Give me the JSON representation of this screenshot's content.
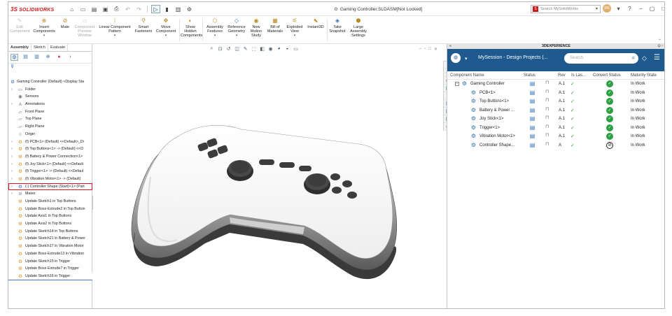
{
  "titlebar": {
    "brand": "SOLIDWORKS",
    "document_title": "Gaming Controller.SLDASM[Not Locked]",
    "search_placeholder": "Search MySolidWorks",
    "avatar_initials": "RN"
  },
  "ribbon": {
    "buttons": [
      {
        "label": "Edit Component",
        "disabled": true
      },
      {
        "label": "Insert Components",
        "disabled": false
      },
      {
        "label": "Mate",
        "disabled": false
      },
      {
        "label": "Component Preview Window",
        "disabled": true
      },
      {
        "label": "Linear Component Pattern",
        "disabled": false
      },
      {
        "label": "Smart Fasteners",
        "disabled": false
      },
      {
        "label": "Move Component",
        "disabled": false
      },
      {
        "label": "Show Hidden Components",
        "disabled": false
      },
      {
        "label": "Assembly Features",
        "disabled": false
      },
      {
        "label": "Reference Geometry",
        "disabled": false
      },
      {
        "label": "New Motion Study",
        "disabled": false
      },
      {
        "label": "Bill of Materials",
        "disabled": false
      },
      {
        "label": "Exploded View",
        "disabled": false
      },
      {
        "label": "Instant3D",
        "disabled": false
      },
      {
        "label": "Take Snapshot",
        "disabled": false
      },
      {
        "label": "Large Assembly Settings",
        "disabled": false
      }
    ]
  },
  "left_pane": {
    "tabs": [
      "Assembly",
      "Sketch",
      "Evaluate"
    ],
    "active_tab": "Assembly",
    "tree": [
      {
        "label": "Gaming Controller (Default) <Display Sta",
        "kind": "root",
        "icon": "assembly-icon"
      },
      {
        "label": "Folder",
        "kind": "folder",
        "icon": "folder-icon"
      },
      {
        "label": "Sensors",
        "kind": "leaf",
        "icon": "sensor-icon"
      },
      {
        "label": "Annotations",
        "kind": "folder",
        "icon": "annotation-icon"
      },
      {
        "label": "Front Plane",
        "kind": "leaf",
        "icon": "plane-icon"
      },
      {
        "label": "Top Plane",
        "kind": "leaf",
        "icon": "plane-icon"
      },
      {
        "label": "Right Plane",
        "kind": "leaf",
        "icon": "plane-icon"
      },
      {
        "label": "Origin",
        "kind": "leaf",
        "icon": "origin-icon"
      },
      {
        "label": "(f) PCB<1> (Default) <<Default>_Di",
        "kind": "part",
        "icon": "part-icon"
      },
      {
        "label": "(f) Top Buttons<1> -> (Default) <<D",
        "kind": "part",
        "icon": "part-icon"
      },
      {
        "label": "(f) Battery & Power Connection<1>",
        "kind": "part",
        "icon": "part-icon"
      },
      {
        "label": "(f) Joy Stick<1> (Default) <<Default",
        "kind": "part",
        "icon": "part-icon"
      },
      {
        "label": "(f) Trigger<1> -> (Default) <<Defaul",
        "kind": "part",
        "icon": "part-icon"
      },
      {
        "label": "(f) Vibration Motor<1> -> (Default)",
        "kind": "part",
        "icon": "part-icon"
      },
      {
        "label": "(-) Controller Shape (Start)<1> (Part",
        "kind": "part-highlight",
        "icon": "part-blue-icon"
      },
      {
        "label": "Mates",
        "kind": "folder",
        "icon": "mates-icon"
      },
      {
        "label": "Update Sketch1 in Top Buttons",
        "kind": "feature",
        "icon": "update-icon"
      },
      {
        "label": "Update Boss-Extrude2 in Top Button",
        "kind": "feature",
        "icon": "update-icon"
      },
      {
        "label": "Update Axis1 in Top Buttons",
        "kind": "feature",
        "icon": "update-icon"
      },
      {
        "label": "Update Axis2 in Top Buttons",
        "kind": "feature",
        "icon": "update-icon"
      },
      {
        "label": "Update Sketch14 in Top Buttons",
        "kind": "feature",
        "icon": "update-icon"
      },
      {
        "label": "Update Sketch21 in Battery & Power",
        "kind": "feature",
        "icon": "update-icon"
      },
      {
        "label": "Update Sketch17 in Vibration Motor",
        "kind": "feature",
        "icon": "update-icon"
      },
      {
        "label": "Update Boss-Extrude13 in Vibration",
        "kind": "feature",
        "icon": "update-icon"
      },
      {
        "label": "Update Sketch15 in Trigger",
        "kind": "feature",
        "icon": "update-icon"
      },
      {
        "label": "Update Boss-Extrude7 in Trigger",
        "kind": "feature",
        "icon": "update-icon"
      },
      {
        "label": "Update Sketch16 in Trigger",
        "kind": "feature",
        "icon": "update-icon"
      }
    ]
  },
  "right_pane": {
    "header": "3DEXPERIENCE",
    "session": "MySession - Design Projects (...",
    "search_placeholder": "Search",
    "columns": [
      "Component Name",
      "Status",
      "Rev",
      "Is Las...",
      "Convert Status",
      "Maturity State"
    ],
    "rows": [
      {
        "name": "Gaming Controller",
        "rev": "A.1",
        "convert": "ok",
        "maturity": "In Work",
        "root": true
      },
      {
        "name": "PCB<1>",
        "rev": "A.1",
        "convert": "ok",
        "maturity": "In Work"
      },
      {
        "name": "Top Buttons<1>",
        "rev": "A.1",
        "convert": "ok",
        "maturity": "In Work"
      },
      {
        "name": "Battery & Power ...",
        "rev": "A.1",
        "convert": "ok",
        "maturity": "In Work"
      },
      {
        "name": "Joy Stick<1>",
        "rev": "A.1",
        "convert": "ok",
        "maturity": "In Work"
      },
      {
        "name": "Trigger<1>",
        "rev": "A.1",
        "convert": "ok",
        "maturity": "In Work"
      },
      {
        "name": "Vibration Motor<1>",
        "rev": "A.1",
        "convert": "ok",
        "maturity": "In Work"
      },
      {
        "name": "Controller Shape...",
        "rev": "A",
        "convert": "blocked",
        "maturity": "In Work"
      }
    ]
  },
  "colors": {
    "accent_blue": "#1e5a8e",
    "highlight_red": "#e0141e",
    "ok_green": "#2ea043"
  }
}
